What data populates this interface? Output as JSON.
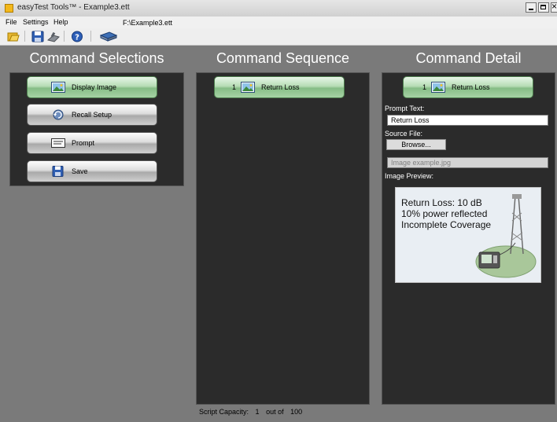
{
  "window": {
    "title": "easyTest Tools™ - Example3.ett"
  },
  "menu": {
    "items": [
      "File",
      "Settings",
      "Help"
    ],
    "file_path": "F:\\Example3.ett"
  },
  "toolbar": {
    "icons": [
      "open-folder-icon",
      "save-icon",
      "instrument-icon",
      "help-icon",
      "connect-device-icon"
    ]
  },
  "columns": {
    "selections_title": "Command Selections",
    "sequence_title": "Command Sequence",
    "detail_title": "Command Detail"
  },
  "selections": [
    {
      "label": "Display Image",
      "icon": "image-icon",
      "selected": true
    },
    {
      "label": "Recall Setup",
      "icon": "recall-icon",
      "selected": false
    },
    {
      "label": "Prompt",
      "icon": "prompt-icon",
      "selected": false
    },
    {
      "label": "Save",
      "icon": "save-icon",
      "selected": false
    }
  ],
  "sequence": [
    {
      "index": "1",
      "label": "Return Loss",
      "icon": "image-icon"
    }
  ],
  "detail": {
    "index": "1",
    "title": "Return Loss",
    "prompt_text_label": "Prompt Text:",
    "prompt_text_value": "Return Loss",
    "source_file_label": "Source File:",
    "browse_label": "Browse...",
    "source_file_placeholder": "Image example.jpg",
    "image_preview_label": "Image Preview:",
    "preview_lines": [
      "Return Loss: 10 dB",
      "10% power reflected",
      "Incomplete Coverage"
    ]
  },
  "status": {
    "capacity_label": "Script Capacity:",
    "used": "1",
    "out_of": "out of",
    "max": "100"
  },
  "colors": {
    "panel_bg": "#2b2b2b",
    "window_bg": "#7a7a7a",
    "selected_green": "#a6d3a5"
  }
}
